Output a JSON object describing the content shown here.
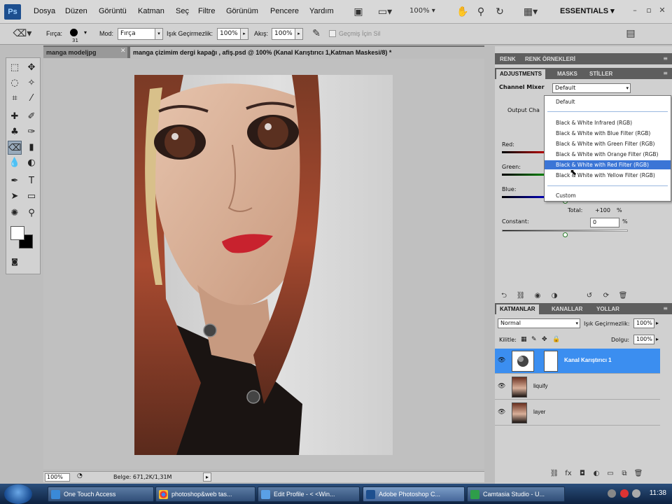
{
  "menubar": {
    "logo": "Ps",
    "items": [
      "Dosya",
      "Düzen",
      "Görüntü",
      "Katman",
      "Seç",
      "Filtre",
      "Görünüm",
      "Pencere",
      "Yardım"
    ],
    "zoom": "100%",
    "workspace": "ESSENTIALS"
  },
  "options": {
    "brush_label": "Fırça:",
    "brush_size": "31",
    "mode_label": "Mod:",
    "mode_value": "Fırça",
    "opacity_label": "Işık Geçirmezlik:",
    "opacity_value": "100%",
    "flow_label": "Akış:",
    "flow_value": "100%",
    "history_label": "Geçmiş İçin Sil"
  },
  "documents": {
    "tab_1": "manga modeljpg",
    "tab_2": "manga çizimim dergi kapağı , afiş.psd @ 100% (Kanal Karıştırıcı 1,Katman Maskesi/8) *"
  },
  "status": {
    "zoom": "100%",
    "doc": "Belge: 671,2K/1,31M"
  },
  "panels": {
    "top_tabs": [
      "RENK",
      "RENK ÖRNEKLERİ"
    ],
    "adj_tabs": [
      "ADJUSTMENTS",
      "MASKS",
      "STİLLER"
    ],
    "channel_mixer_label": "Channel Mixer",
    "preset_value": "Default",
    "output_channel_label": "Output Cha",
    "red_label": "Red:",
    "green_label": "Green:",
    "blue_label": "Blue:",
    "total_label": "Total:",
    "total_value": "+100",
    "total_unit": "%",
    "constant_label": "Constant:",
    "constant_value": "0",
    "constant_unit": "%"
  },
  "preset_menu": {
    "items": [
      "Default",
      "Black & White Infrared (RGB)",
      "Black & White with Blue Filter (RGB)",
      "Black & White with Green Filter (RGB)",
      "Black & White with Orange Filter (RGB)",
      "Black & White with Red Filter (RGB)",
      "Black & White with Yellow Filter (RGB)",
      "Custom"
    ],
    "selected_index": 5
  },
  "layers": {
    "tabs": [
      "KATMANLAR",
      "KANALLAR",
      "YOLLAR"
    ],
    "blend_mode": "Normal",
    "opacity_label": "Işık Geçirmezlik:",
    "opacity_value": "100%",
    "lock_label": "Kilitle:",
    "fill_label": "Dolgu:",
    "fill_value": "100%",
    "rows": [
      "Kanal Karıştırıcı 1",
      "liquify",
      "layer"
    ]
  },
  "taskbar": {
    "buttons": [
      "One Touch Access",
      "photoshop&web tas...",
      "Edit Profile - < <Win...",
      "Adobe Photoshop C...",
      "Camtasia Studio - U..."
    ],
    "time": "11:38"
  },
  "colors": {
    "accent": "#3b8ef0",
    "menu_selected": "#3b75d6",
    "panel_bg": "#d0d0d0",
    "panel_header": "#5e5e5e"
  }
}
